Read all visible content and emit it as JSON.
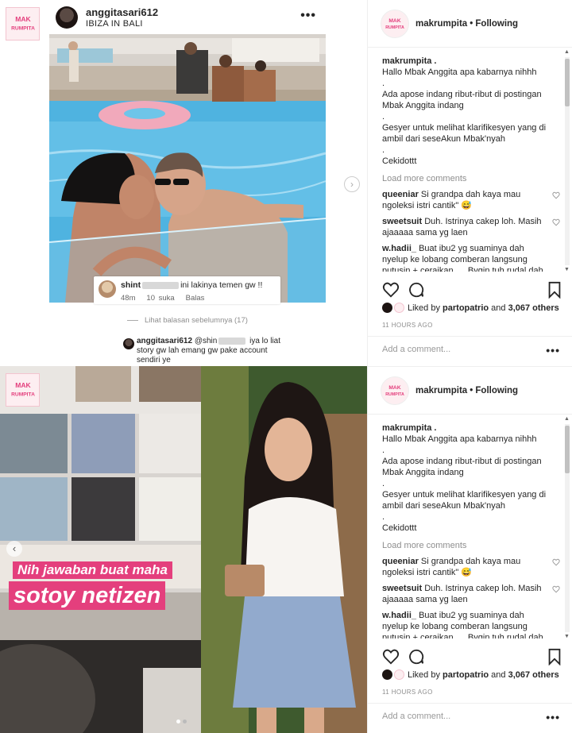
{
  "post1": {
    "username": "anggitasari612",
    "location": "IBIZA IN BALI",
    "more": "•••",
    "popup_comment": {
      "user": "shint",
      "text": "ini lakinya temen gw !!",
      "time": "48m",
      "likes": "10 suka",
      "reply": "Balas"
    },
    "view_replies": "Lihat balasan sebelumnya (17)",
    "reply": {
      "user": "anggitasari612",
      "mention": "@shin",
      "text": "iya lo liat story gw lah emang gw pake account sendiri ye"
    }
  },
  "story": {
    "banner_line1": "Nih jawaban buat maha",
    "banner_line2": "sotoy netizen",
    "prev": "‹"
  },
  "logo_text": {
    "line1": "MAK",
    "line2": "RUMPITA"
  },
  "panel": {
    "account": "makrumpita",
    "following": "• Following",
    "caption_user": "makrumpita .",
    "caption_lines": [
      "Hallo Mbak Anggita apa kabarnya nihhh",
      ".",
      "Ada apose indang ribut-ribut di postingan Mbak Anggita indang",
      ".",
      "Gesyer untuk melihat klarifikesyen yang di ambil dari seseAkun Mbak'nyah",
      ".",
      "Cekidottt"
    ],
    "load_more": "Load more comments",
    "comments": [
      {
        "user": "queeniar",
        "text": "Si grandpa dah kaya mau ngoleksi istri cantik\" 😅"
      },
      {
        "user": "sweetsuit",
        "text": "Duh. Istrinya cakep loh. Masih ajaaaaa sama yg laen"
      },
      {
        "user": "w.hadii_",
        "text": "Buat ibu2 yg suaminya dah nyelup ke lobang comberan langsung putusin + ceraikan .... Bygin tuh rudal dah"
      }
    ],
    "liked_by_prefix": "Liked by",
    "liked_by_user": "partopatrio",
    "liked_by_and": "and",
    "liked_by_count": "3,067 others",
    "time": "11 HOURS AGO",
    "comment_placeholder": "Add a comment...",
    "more": "•••"
  }
}
